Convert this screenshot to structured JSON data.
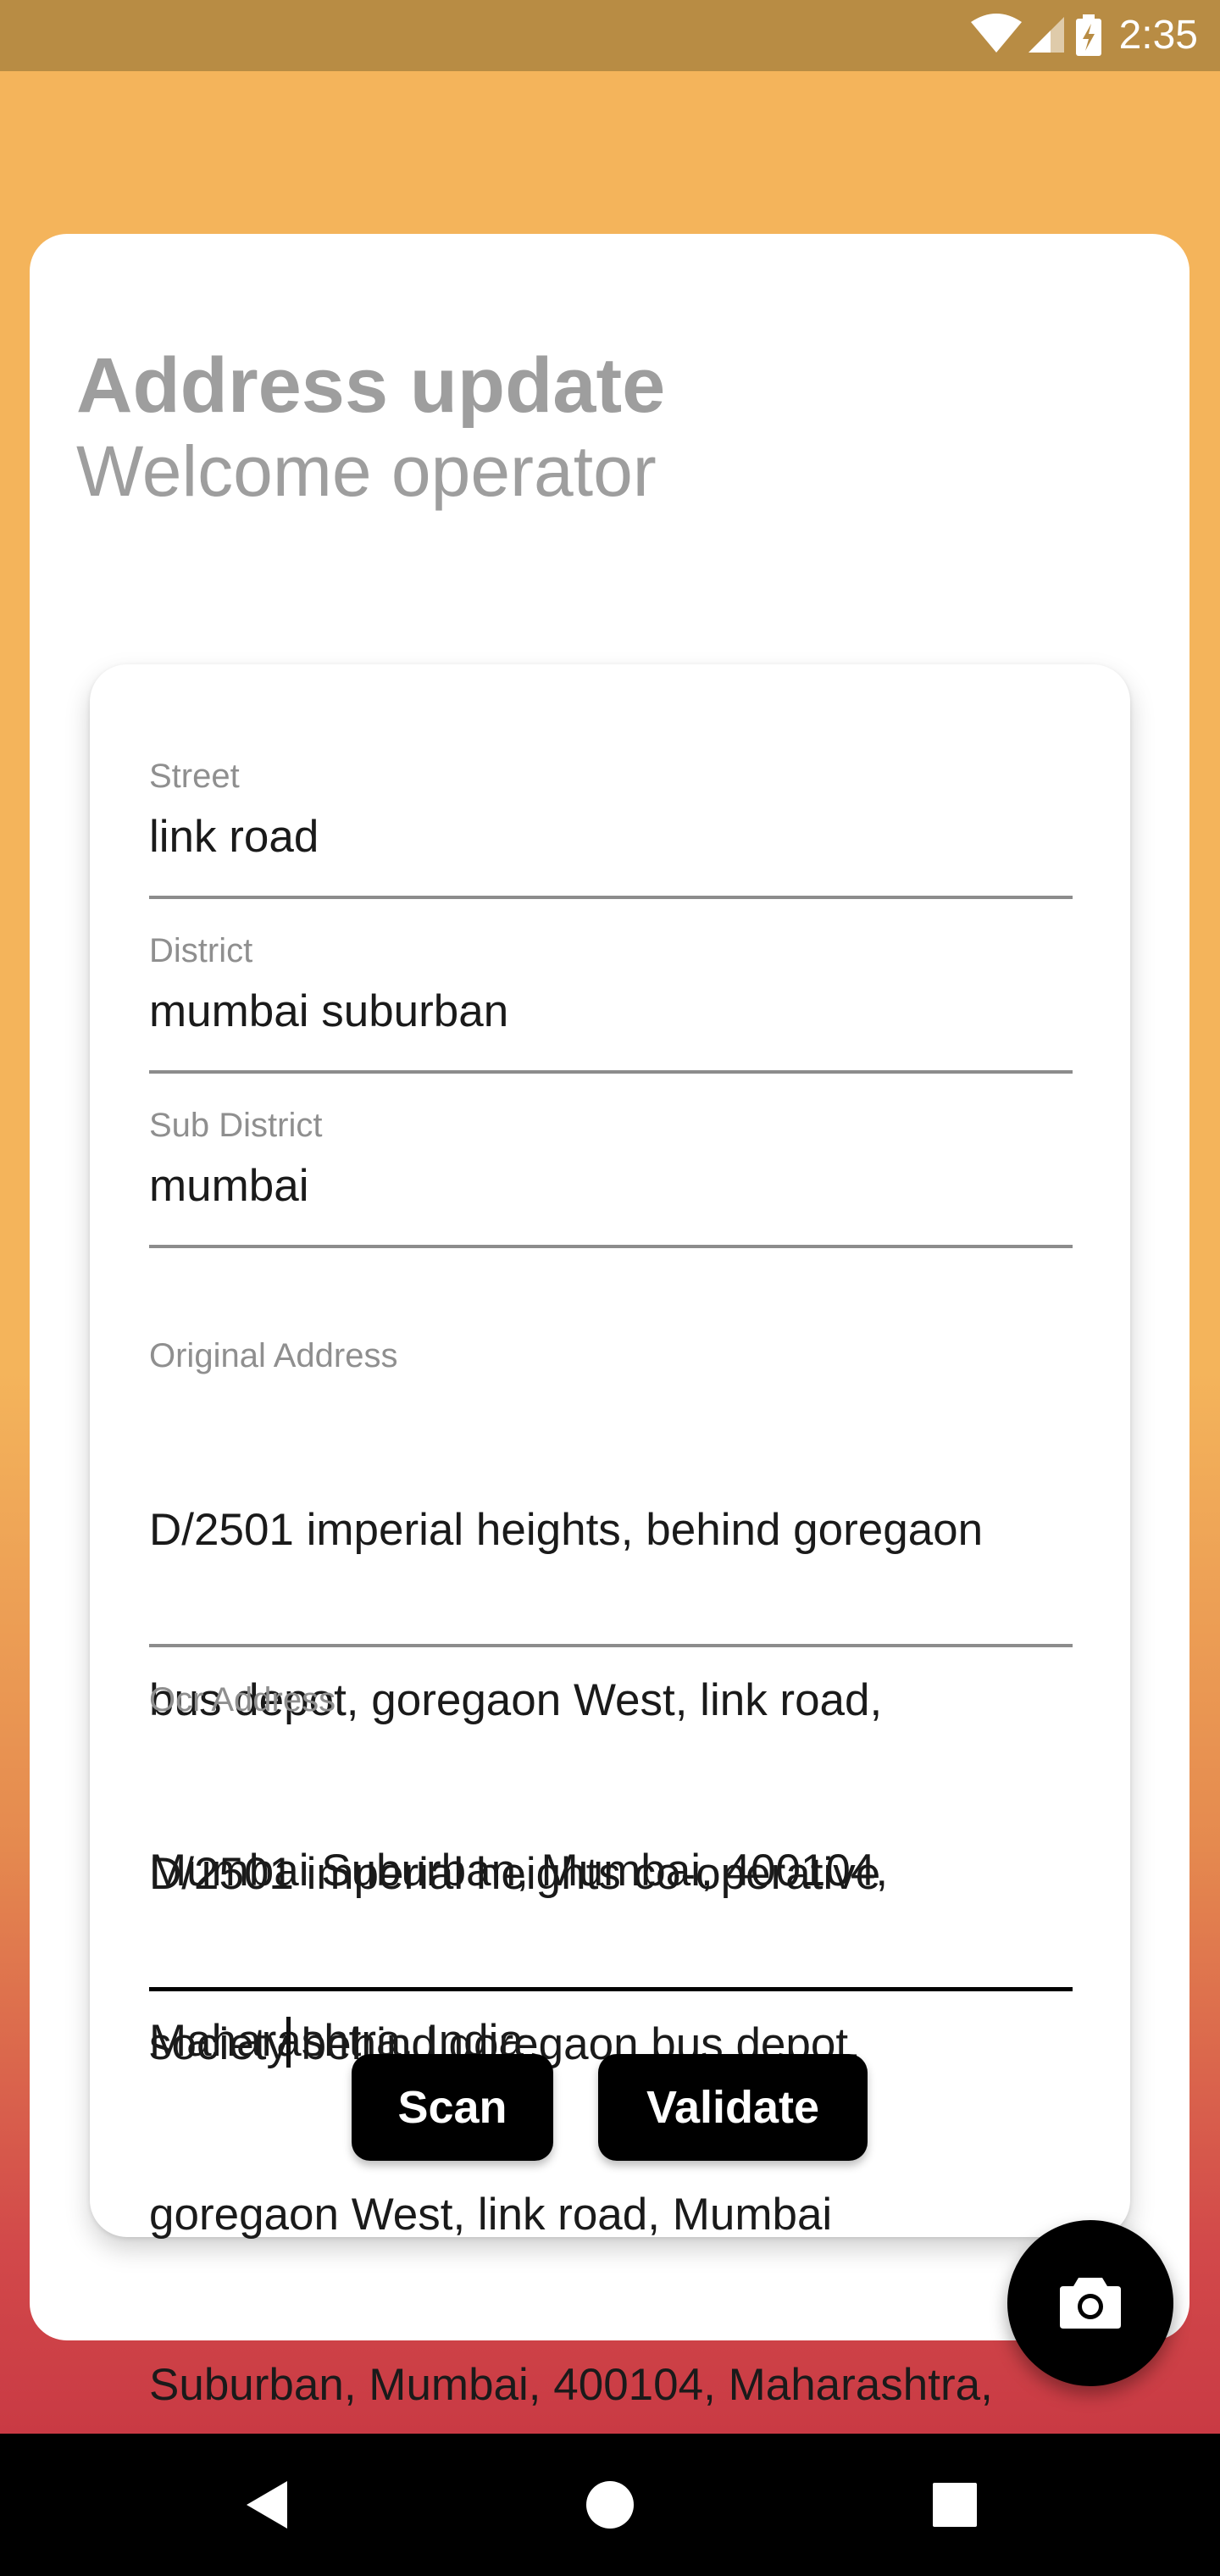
{
  "status_bar": {
    "time": "2:35",
    "icons": [
      "wifi-icon",
      "cellular-signal-icon",
      "battery-charging-icon"
    ]
  },
  "header": {
    "title": "Address update",
    "subtitle": "Welcome operator"
  },
  "form": {
    "street": {
      "label": "Street",
      "value": "link road"
    },
    "district": {
      "label": "District",
      "value": "mumbai suburban"
    },
    "sub_district": {
      "label": "Sub District",
      "value": "mumbai"
    },
    "original_address": {
      "label": "Original Address",
      "lines": [
        "D/2501 imperial heights, behind goregaon",
        "bus depot, goregaon West, link road,",
        "Mumbai Suburban, Mumbai, 400104,",
        "Maharashtra, India"
      ]
    },
    "ocr_address": {
      "label": "Ocr Address",
      "line1": "D/2501 imperial heights co-operative",
      "line2_before_caret": "society",
      "line2_after_caret": " behind goregaon bus depot,",
      "line3": "goregaon West, link road, Mumbai",
      "line4": "Suburban, Mumbai, 400104, Maharashtra,"
    }
  },
  "buttons": {
    "scan": "Scan",
    "validate": "Validate"
  },
  "fab": {
    "icon": "camera-icon"
  },
  "nav_bar": {
    "icons": [
      "back-icon",
      "home-icon",
      "recents-icon"
    ]
  },
  "colors": {
    "status_bar": "#b88c44",
    "gradient_top": "#f4b45b",
    "gradient_bottom": "#c93a44",
    "button": "#000000",
    "muted_text": "#9e9e9e"
  }
}
